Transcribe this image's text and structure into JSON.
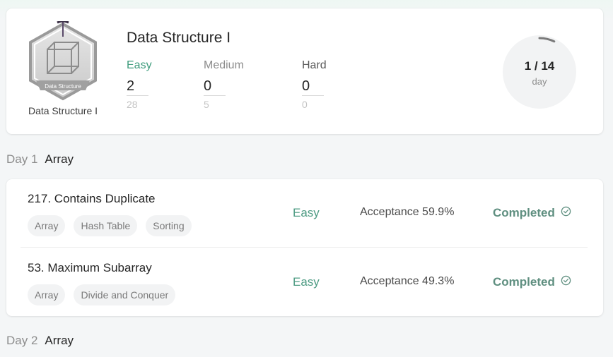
{
  "plan": {
    "badge_text": "Data Structure",
    "caption": "Data Structure I",
    "title": "Data Structure I",
    "difficulties": [
      {
        "label": "Easy",
        "solved": "2",
        "total": "28",
        "color": "#3f9c7d"
      },
      {
        "label": "Medium",
        "solved": "0",
        "total": "5",
        "color": "#8c8c8c"
      },
      {
        "label": "Hard",
        "solved": "0",
        "total": "0",
        "color": "#5a5a5a"
      }
    ],
    "progress": {
      "text": "1 / 14",
      "unit": "day",
      "fraction": 0.0714
    }
  },
  "days": [
    {
      "label": "Day 1",
      "topic": "Array",
      "problems": [
        {
          "title": "217. Contains Duplicate",
          "tags": [
            "Array",
            "Hash Table",
            "Sorting"
          ],
          "difficulty": "Easy",
          "acceptance": "Acceptance 59.9%",
          "status": "Completed"
        },
        {
          "title": "53. Maximum Subarray",
          "tags": [
            "Array",
            "Divide and Conquer"
          ],
          "difficulty": "Easy",
          "acceptance": "Acceptance 49.3%",
          "status": "Completed"
        }
      ]
    },
    {
      "label": "Day 2",
      "topic": "Array"
    }
  ],
  "colors": {
    "easy": "#4f9c84",
    "completed": "#5f8f80",
    "progress_arc": "#7a7a7a"
  },
  "icons": {
    "badge": "cube-hexagon-badge-icon",
    "status": "check-circle-icon"
  }
}
